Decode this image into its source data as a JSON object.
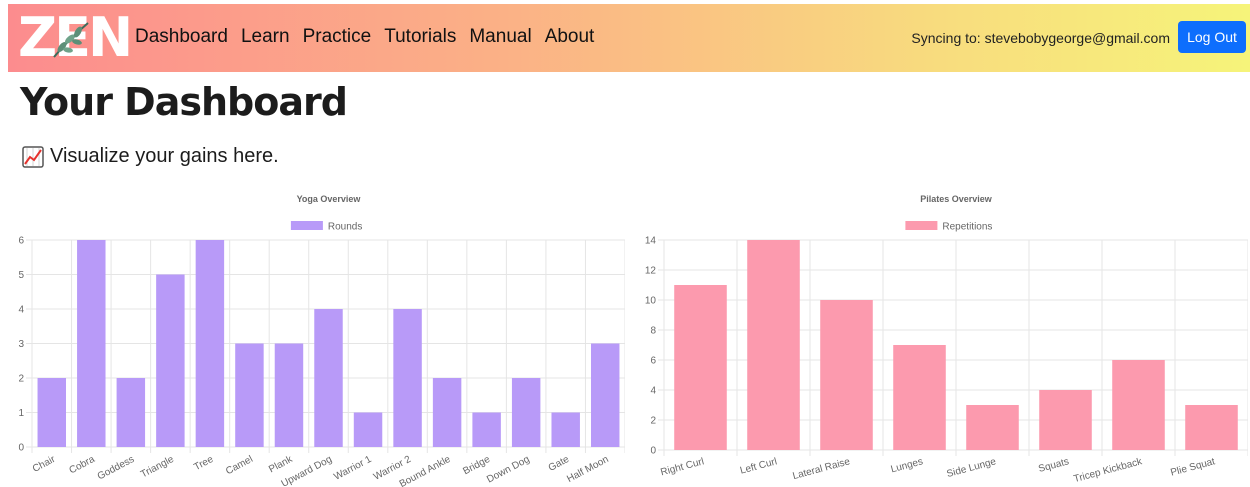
{
  "nav": {
    "logo_text": "ZEN",
    "links": [
      "Dashboard",
      "Learn",
      "Practice",
      "Tutorials",
      "Manual",
      "About"
    ],
    "sync_text": "Syncing to: stevebobygeorge@gmail.com",
    "logout_label": "Log Out"
  },
  "page": {
    "title": "Your Dashboard",
    "subtitle": "Visualize your gains here.",
    "subtitle_icon": "chart-increasing-icon"
  },
  "colors": {
    "yoga_bar": "#b89af8",
    "pilates_bar": "#fc9aae",
    "logout": "#0d6efd"
  },
  "chart_data": [
    {
      "type": "bar",
      "title": "Yoga Overview",
      "series": [
        {
          "name": "Rounds",
          "values": [
            2,
            6,
            2,
            5,
            6,
            3,
            3,
            4,
            1,
            4,
            2,
            1,
            2,
            1,
            3
          ]
        }
      ],
      "categories": [
        "Chair",
        "Cobra",
        "Goddess",
        "Triangle",
        "Tree",
        "Camel",
        "Plank",
        "Upward Dog",
        "Warrior 1",
        "Warrior 2",
        "Bound Ankle",
        "Bridge",
        "Down Dog",
        "Gate",
        "Half Moon"
      ],
      "ylim": [
        0,
        6
      ],
      "yticks": [
        0,
        1,
        2,
        3,
        4,
        5,
        6
      ],
      "grid": true,
      "legend": "top"
    },
    {
      "type": "bar",
      "title": "Pilates Overview",
      "series": [
        {
          "name": "Repetitions",
          "values": [
            11,
            14,
            10,
            7,
            3,
            4,
            6,
            3
          ]
        }
      ],
      "categories": [
        "Right Curl",
        "Left Curl",
        "Lateral Raise",
        "Lunges",
        "Side Lunge",
        "Squats",
        "Tricep Kickback",
        "Plie Squat"
      ],
      "ylim": [
        0,
        14
      ],
      "yticks": [
        0,
        2,
        4,
        6,
        8,
        10,
        12,
        14
      ],
      "grid": true,
      "legend": "top"
    }
  ]
}
